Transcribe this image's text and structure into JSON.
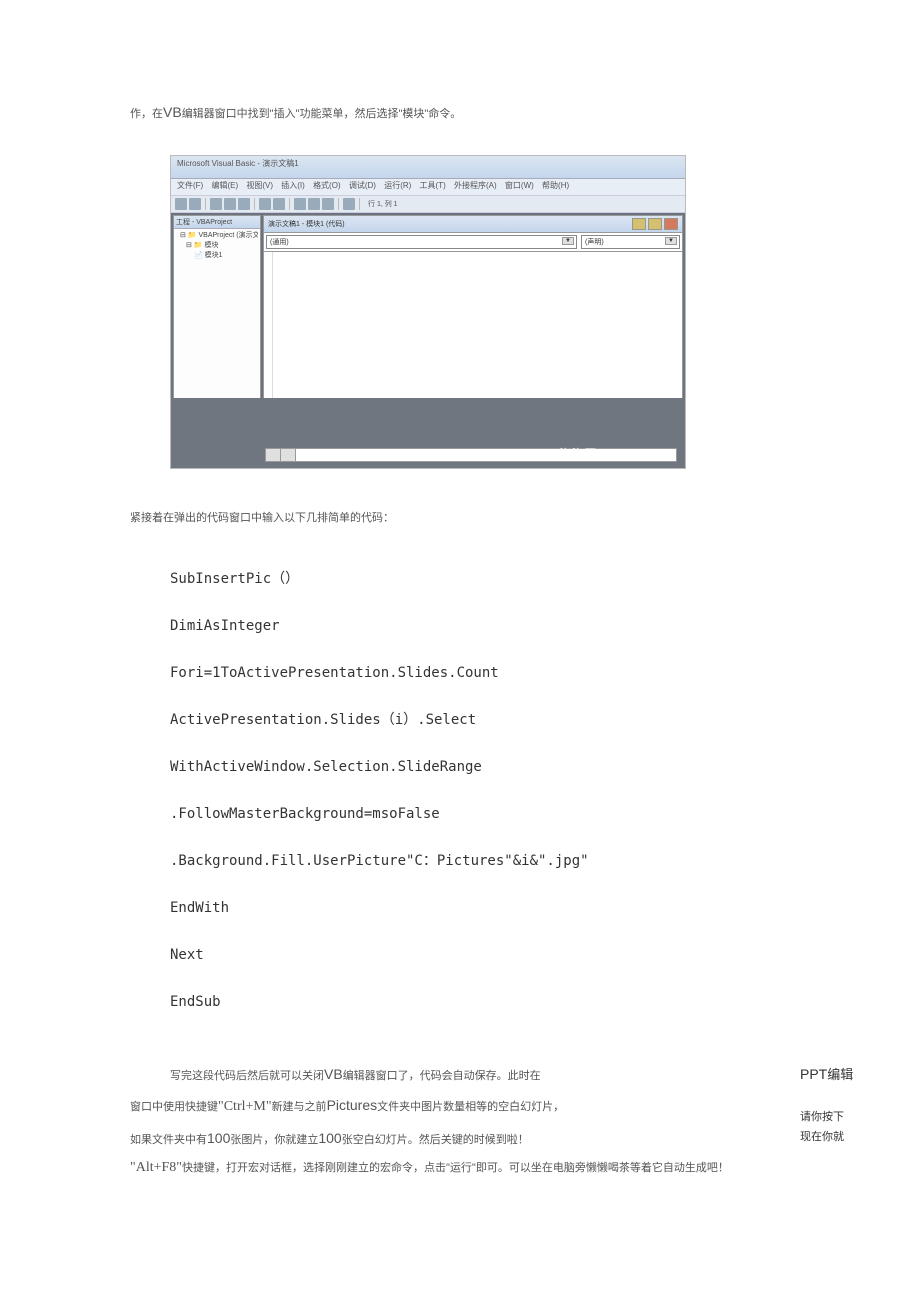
{
  "intro": {
    "prefix": "作，在",
    "vb": "VB",
    "rest": "编辑器窗口中找到\"插入\"功能菜单，然后选择\"模块\"命令。"
  },
  "screenshot": {
    "title": "Microsoft Visual Basic - 演示文稿1",
    "menus": [
      "文件(F)",
      "编辑(E)",
      "视图(V)",
      "插入(I)",
      "格式(O)",
      "调试(D)",
      "运行(R)",
      "工具(T)",
      "外接程序(A)",
      "窗口(W)",
      "帮助(H)"
    ],
    "toolbar_text": "行 1, 列 1",
    "tree_title": "工程 - VBAProject",
    "tree": [
      "VBAProject (演示文稿",
      "模块",
      "模块1"
    ],
    "code_title": "演示文稿1 - 模块1 (代码)",
    "dd1": "(通用)",
    "dd2": "(声明)",
    "watermark": "泡泡网  PCPOP.COM"
  },
  "intro2": "紧接着在弹出的代码窗口中输入以下几排简单的代码：",
  "code": [
    "SubInsertPic（）",
    "DimiAsInteger",
    "Fori=1ToActivePresentation.Slides.Count",
    "ActivePresentation.Slides（i）.Select",
    "WithActiveWindow.Selection.SlideRange",
    ".FollowMasterBackground=msoFalse",
    ".Background.Fill.UserPicture\"C：Pictures\"&i&\".jpg\"",
    "EndWith",
    "Next",
    "EndSub"
  ],
  "bottom": {
    "l1a": "写完这段代码后然后就可以关闭",
    "l1b": "VB",
    "l1c": "编辑器窗口了，代码会自动保存。此时在",
    "r1a": "PPT",
    "r1b": "编辑",
    "l2a": "窗口中使用快捷键",
    "l2b": "\"Ctrl+M\"",
    "l2c": "新建与之前",
    "l2d": "Pictures",
    "l2e": "文件夹中图片数量相等的空白幻灯片，",
    "r2": "请你按下",
    "l3a": "如果文件夹中有",
    "l3b": "100",
    "l3c": "张图片，你就建立",
    "l3d": "100",
    "l3e": "张空白幻灯片。然后关键的时候到啦！",
    "r3": "现在你就",
    "l4a": "\"Alt+F8\"",
    "l4b": "快捷键，打开宏对话框，选择刚刚建立的宏命令，点击\"运行\"即可。可以坐在电脑旁懒懒喝茶等着它自动生成吧！"
  }
}
